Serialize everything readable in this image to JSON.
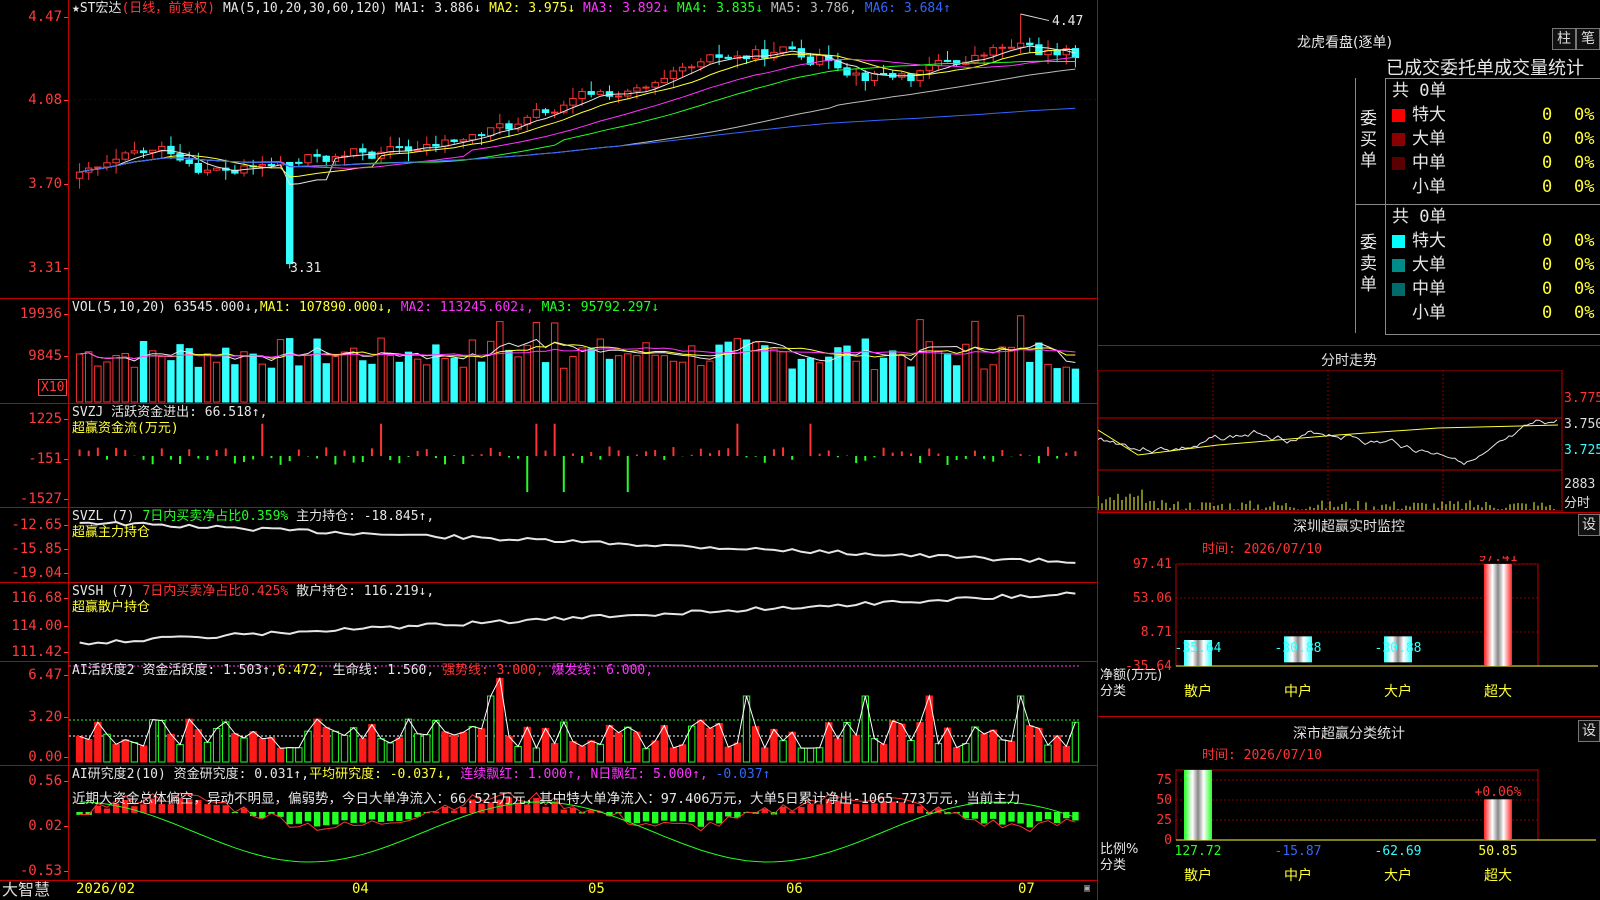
{
  "app": {
    "brand": "大智慧"
  },
  "main": {
    "stock": "★ST宏达",
    "period": "(日线，前复权)",
    "ma_def": "MA(5,10,20,30,60,120)",
    "ma": [
      {
        "label": "MA1:",
        "value": "3.886↓",
        "color": "#e6e6e6"
      },
      {
        "label": "MA2:",
        "value": "3.975↓",
        "color": "#ffff33"
      },
      {
        "label": "MA3:",
        "value": "3.892↓",
        "color": "#ff33ff"
      },
      {
        "label": "MA4:",
        "value": "3.835↓",
        "color": "#22ff22"
      },
      {
        "label": "MA5:",
        "value": "3.786,",
        "color": "#bbbbbb"
      },
      {
        "label": "MA6:",
        "value": "3.684↑",
        "color": "#3366ff"
      }
    ],
    "yticks": [
      "4.47",
      "4.08",
      "3.70",
      "3.31"
    ],
    "high_label": "4.47",
    "low_label": "3.31"
  },
  "vol": {
    "def": "VOL(5,10,20)",
    "value": "63545.000↓,",
    "ma1": "MA1: 107890.000↓,",
    "ma2": "MA2: 113245.602↓,",
    "ma3": "MA3: 95792.297↓",
    "yticks": [
      "19936",
      "9845"
    ],
    "unit": "X10"
  },
  "svzj": {
    "def": "SVZJ",
    "text": "活跃资金进出: 66.518↑,",
    "sub": "超赢资金流(万元)",
    "yticks": [
      "1225",
      "-151",
      "-1527"
    ]
  },
  "svzl": {
    "def": "SVZL (7)",
    "ratio": "7日内买卖净占比0.359%",
    "text": "主力持仓: -18.845↑,",
    "sub": "超赢主力持仓",
    "yticks": [
      "-12.65",
      "-15.85",
      "-19.04"
    ]
  },
  "svsh": {
    "def": "SVSH (7)",
    "ratio": "7日内买卖净占比0.425%",
    "text": "散户持仓: 116.219↓,",
    "sub": "超赢散户持仓",
    "yticks": [
      "116.68",
      "114.00",
      "111.42"
    ]
  },
  "ai1": {
    "def": "AI活跃度2",
    "t1": "资金活跃度: 1.503↑,",
    "t2": "6.472,",
    "t3": "生命线: 1.560,",
    "t4": "强势线: 3.000,",
    "t5": "爆发线: 6.000,",
    "yticks": [
      "6.47",
      "3.20",
      "0.00"
    ]
  },
  "ai2": {
    "def": "AI研究度2(10)",
    "t1": "资金研究度: 0.031↑,",
    "t2": "平均研究度: -0.037↓,",
    "t3": "连续飘红: 1.000↑,",
    "t4": "N日飘红: 5.000↑,",
    "t5": "-0.037↑",
    "comment": "近期大资金总体偏空，异动不明显，偏弱势，今日大单净流入：66.521万元，其中特大单净流入：97.406万元，大单5日累计净出-1065.773万元，当前主力",
    "yticks": [
      "0.56",
      "0.02",
      "-0.53"
    ]
  },
  "xaxis": [
    "2026/02",
    "04",
    "05",
    "06",
    "07"
  ],
  "right": {
    "lh_title": "龙虎看盘(逐单)",
    "btn1": "柱",
    "btn2": "笔",
    "stat_title": "已成交委托单成交量统计",
    "buy_label": "委买单",
    "sell_label": "委卖单",
    "buy_total": "共 0单",
    "sell_total": "共 0单",
    "buy_rows": [
      {
        "name": "特大",
        "v": "0",
        "p": "0%",
        "color": "#ff0000"
      },
      {
        "name": "大单",
        "v": "0",
        "p": "0%",
        "color": "#8b0000"
      },
      {
        "name": "中单",
        "v": "0",
        "p": "0%",
        "color": "#5a0000"
      },
      {
        "name": "小单",
        "v": "0",
        "p": "0%",
        "color": ""
      }
    ],
    "sell_rows": [
      {
        "name": "特大",
        "v": "0",
        "p": "0%",
        "color": "#00ffff"
      },
      {
        "name": "大单",
        "v": "0",
        "p": "0%",
        "color": "#008b8b"
      },
      {
        "name": "中单",
        "v": "0",
        "p": "0%",
        "color": "#006b6b"
      },
      {
        "name": "小单",
        "v": "0",
        "p": "0%",
        "color": ""
      }
    ],
    "intraday_title": "分时走势",
    "intraday_yticks": [
      "3.775",
      "3.750",
      "3.725"
    ],
    "intraday_vol": "2883",
    "intraday_vol_label": "分时",
    "sz_title": "深圳超赢实时监控",
    "sz_btn": "设",
    "sz_time": "时间: 2026/07/10",
    "sz_yticks": [
      "97.41",
      "53.06",
      "8.71",
      "-35.64"
    ],
    "sz_ylabel1": "净额(万元)",
    "sz_ylabel2": "分类",
    "sz_vals": [
      "-35.64",
      "-30.88",
      "-30.88",
      "97.41"
    ],
    "cats": [
      "散户",
      "中户",
      "大户",
      "超大"
    ],
    "cls_title": "深市超赢分类统计",
    "cls_btn": "设",
    "cls_time": "时间: 2026/07/10",
    "cls_yticks": [
      "75",
      "50",
      "25",
      "0"
    ],
    "cls_ylabel1": "比例%",
    "cls_ylabel2": "分类",
    "cls_vals": [
      "127.72",
      "-15.87",
      "-62.69",
      "50.85"
    ],
    "cls_pct": "+0.06%"
  }
}
